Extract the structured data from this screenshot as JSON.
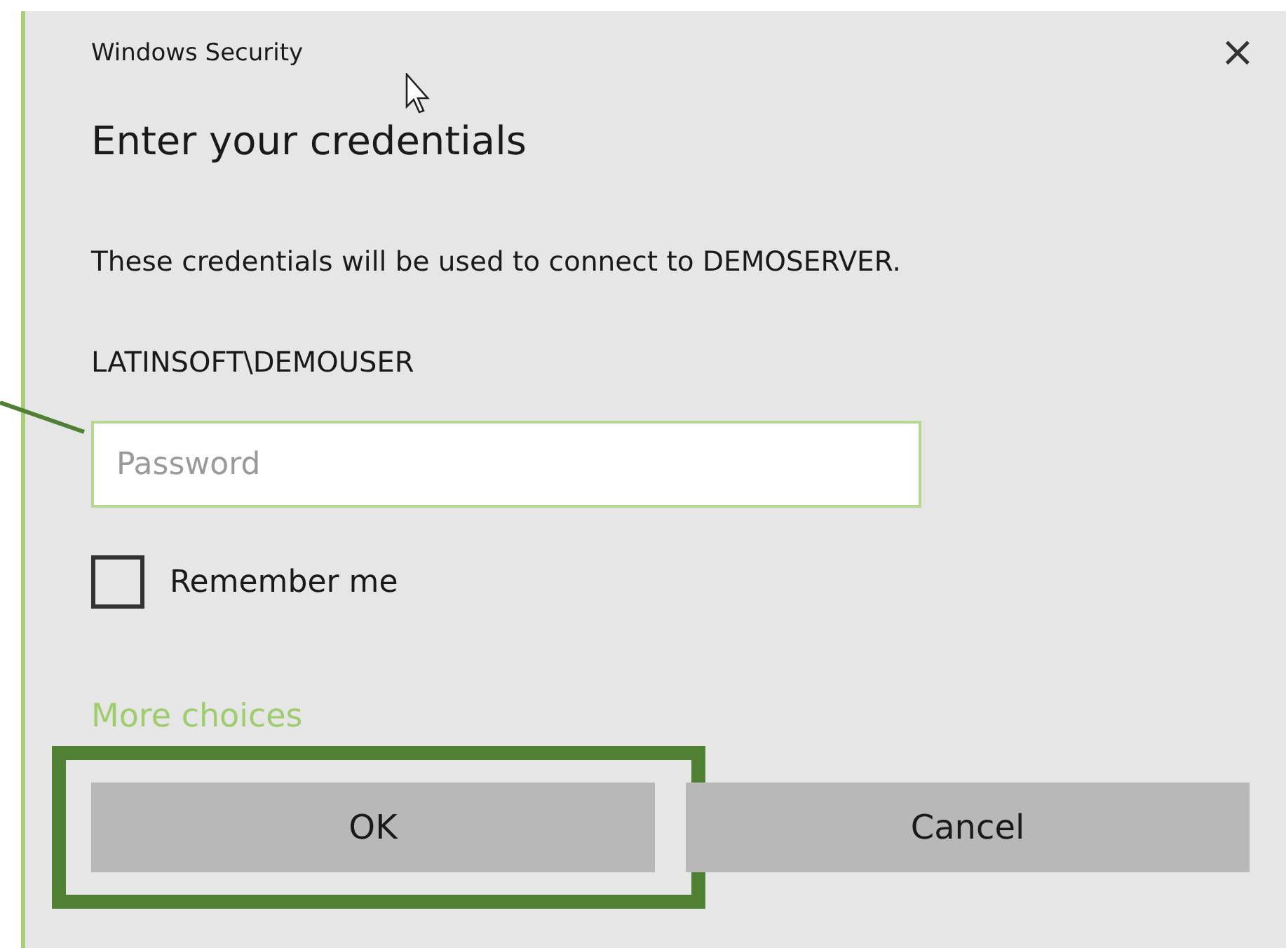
{
  "window": {
    "title": "Windows Security",
    "close": "×"
  },
  "heading": "Enter your credentials",
  "description": "These credentials will be used to connect to DEMOSERVER.",
  "username": "LATINSOFT\\DEMOUSER",
  "password": {
    "placeholder": "Password"
  },
  "remember": {
    "label": "Remember me",
    "checked": false
  },
  "more_choices": "More choices",
  "buttons": [
    {
      "label": "OK",
      "highlighted": true
    },
    {
      "label": "Cancel",
      "highlighted": false
    }
  ]
}
